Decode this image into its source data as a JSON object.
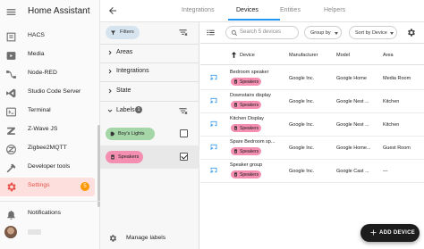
{
  "app": {
    "title": "Home Assistant"
  },
  "sidebar": {
    "items": [
      {
        "label": "HACS",
        "icon": "hacs-icon"
      },
      {
        "label": "Media",
        "icon": "media-icon"
      },
      {
        "label": "Node-RED",
        "icon": "node-red-icon"
      },
      {
        "label": "Studio Code Server",
        "icon": "vscode-icon"
      },
      {
        "label": "Terminal",
        "icon": "terminal-icon"
      },
      {
        "label": "Z-Wave JS",
        "icon": "zwave-icon"
      },
      {
        "label": "Zigbee2MQTT",
        "icon": "zigbee-icon"
      },
      {
        "label": "Developer tools",
        "icon": "hammer-icon"
      },
      {
        "label": "Settings",
        "icon": "gear-icon",
        "active": true,
        "badge": "5"
      }
    ],
    "notifications_label": "Notifications"
  },
  "tabs": [
    {
      "label": "Integrations",
      "active": false
    },
    {
      "label": "Devices",
      "active": true
    },
    {
      "label": "Entities",
      "active": false
    },
    {
      "label": "Helpers",
      "active": false
    }
  ],
  "filters": {
    "chip_label": "Filters",
    "sections": [
      {
        "label": "Areas"
      },
      {
        "label": "Integrations"
      },
      {
        "label": "State"
      },
      {
        "label": "Labels",
        "count": "1"
      }
    ],
    "labels": [
      {
        "name": "Boy's Lights",
        "color": "#a5d6a7",
        "checked": false
      },
      {
        "name": "Speakers",
        "color": "#f48fb1",
        "checked": true
      }
    ],
    "manage_labels": "Manage labels"
  },
  "toolbar": {
    "search_placeholder": "Search 5 devices",
    "group_by": "Group by",
    "sort_by": "Sort by Device"
  },
  "table": {
    "headers": [
      "Device",
      "Manufacturer",
      "Model",
      "Area"
    ],
    "rows": [
      {
        "device": "Bedroom speaker",
        "label": "Speakers",
        "manufacturer": "Google Inc.",
        "model": "Google Home",
        "area": "Media Room"
      },
      {
        "device": "Downstairs display",
        "label": "Speakers",
        "manufacturer": "Google Inc.",
        "model": "Google Nest ...",
        "area": "Kitchen"
      },
      {
        "device": "Kitchen Display",
        "label": "Speakers",
        "manufacturer": "Google Inc.",
        "model": "Google Nest ...",
        "area": "Kitchen"
      },
      {
        "device": "Spare Bedroom sp...",
        "label": "Speakers",
        "manufacturer": "Google Inc.",
        "model": "Google Home...",
        "area": "Guest Room"
      },
      {
        "device": "Speaker group",
        "label": "Speakers",
        "manufacturer": "Google Inc.",
        "model": "Google Cast ...",
        "area": "—"
      }
    ]
  },
  "fab_label": "ADD DEVICE",
  "colors": {
    "accent": "#2196f3",
    "active": "#e8514a",
    "badge": "#ff9800",
    "speakers_label": "#f48fb1",
    "boys_lights_label": "#a5d6a7"
  }
}
